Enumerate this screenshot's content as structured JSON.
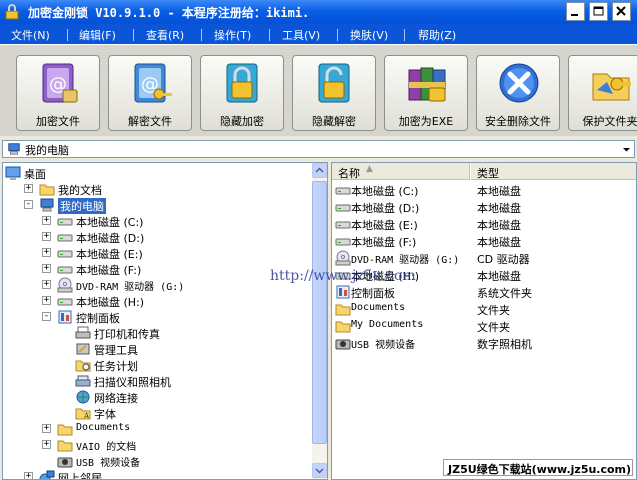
{
  "window": {
    "title": "加密金刚锁 V10.9.1.0 - 本程序注册给：ikimi."
  },
  "menu": [
    {
      "label": "文件(N)"
    },
    {
      "label": "编辑(F)"
    },
    {
      "label": "查看(R)"
    },
    {
      "label": "操作(T)"
    },
    {
      "label": "工具(V)"
    },
    {
      "label": "换肤(V)"
    },
    {
      "label": "帮助(Z)"
    }
  ],
  "toolbar": [
    {
      "label": "加密文件",
      "icon": "encrypt-file-icon"
    },
    {
      "label": "解密文件",
      "icon": "decrypt-file-icon"
    },
    {
      "label": "隐藏加密",
      "icon": "hide-encrypt-icon"
    },
    {
      "label": "隐藏解密",
      "icon": "hide-decrypt-icon"
    },
    {
      "label": "加密为EXE",
      "icon": "encrypt-exe-icon"
    },
    {
      "label": "安全删除文件",
      "icon": "secure-delete-icon"
    },
    {
      "label": "保护文件夹",
      "icon": "protect-folder-icon"
    }
  ],
  "address": {
    "value": "我的电脑"
  },
  "tree": [
    {
      "label": "桌面",
      "icon": "desktop-icon"
    },
    {
      "label": "我的文档",
      "icon": "folder-icon"
    },
    {
      "label": "我的电脑",
      "icon": "computer-icon",
      "selected": true
    },
    {
      "label": "本地磁盘 (C:)",
      "icon": "drive-icon"
    },
    {
      "label": "本地磁盘 (D:)",
      "icon": "drive-icon"
    },
    {
      "label": "本地磁盘 (E:)",
      "icon": "drive-icon"
    },
    {
      "label": "本地磁盘 (F:)",
      "icon": "drive-icon"
    },
    {
      "label": "DVD-RAM 驱动器 (G:)",
      "icon": "dvd-icon"
    },
    {
      "label": "本地磁盘 (H:)",
      "icon": "drive-icon"
    },
    {
      "label": "控制面板",
      "icon": "control-panel-icon"
    },
    {
      "label": "打印机和传真",
      "icon": "printer-icon"
    },
    {
      "label": "管理工具",
      "icon": "admin-tools-icon"
    },
    {
      "label": "任务计划",
      "icon": "task-folder-icon"
    },
    {
      "label": "扫描仪和照相机",
      "icon": "scanner-icon"
    },
    {
      "label": "网络连接",
      "icon": "network-icon"
    },
    {
      "label": "字体",
      "icon": "font-folder-icon"
    },
    {
      "label": "Documents",
      "icon": "folder-icon"
    },
    {
      "label": "VAIO 的文档",
      "icon": "folder-icon"
    },
    {
      "label": "USB 视频设备",
      "icon": "camera-icon"
    },
    {
      "label": "网上邻居",
      "icon": "network-places-icon"
    }
  ],
  "list": {
    "col_name": "名称",
    "col_type": "类型",
    "rows": [
      {
        "name": "本地磁盘 (C:)",
        "type": "本地磁盘",
        "icon": "drive-icon"
      },
      {
        "name": "本地磁盘 (D:)",
        "type": "本地磁盘",
        "icon": "drive-icon"
      },
      {
        "name": "本地磁盘 (E:)",
        "type": "本地磁盘",
        "icon": "drive-icon"
      },
      {
        "name": "本地磁盘 (F:)",
        "type": "本地磁盘",
        "icon": "drive-icon"
      },
      {
        "name": "DVD-RAM 驱动器 (G:)",
        "type": "CD 驱动器",
        "icon": "dvd-icon"
      },
      {
        "name": "本地磁盘 (H:)",
        "type": "本地磁盘",
        "icon": "drive-icon"
      },
      {
        "name": "控制面板",
        "type": "系统文件夹",
        "icon": "control-panel-icon"
      },
      {
        "name": "Documents",
        "type": "文件夹",
        "icon": "folder-icon"
      },
      {
        "name": "My Documents",
        "type": "文件夹",
        "icon": "folder-icon"
      },
      {
        "name": "USB 视频设备",
        "type": "数字照相机",
        "icon": "camera-icon"
      }
    ]
  },
  "watermark": "http://www.jz5u.com",
  "site_badge": "JZ5U绿色下载站(www.jz5u.com)"
}
